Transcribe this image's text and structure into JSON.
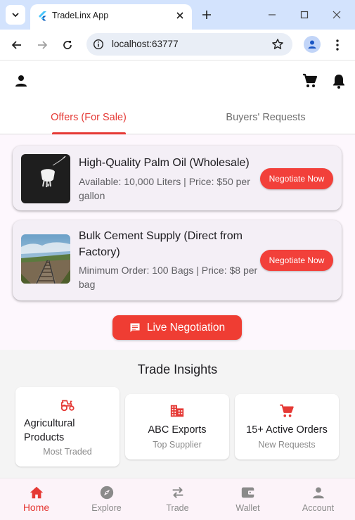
{
  "browser": {
    "tab_title": "TradeLinx App",
    "url": "localhost:63777"
  },
  "app": {
    "tabs": [
      {
        "label": "Offers (For Sale)",
        "active": true
      },
      {
        "label": "Buyers' Requests",
        "active": false
      }
    ],
    "offers": [
      {
        "title": "High-Quality Palm Oil (Wholesale)",
        "subtitle": "Available: 10,000 Liters | Price: $50 per gallon",
        "button": "Negotiate Now",
        "thumbnail": "palm-oil-photo"
      },
      {
        "title": "Bulk Cement Supply (Direct from Factory)",
        "subtitle": "Minimum Order: 100 Bags | Price: $8 per bag",
        "button": "Negotiate Now",
        "thumbnail": "railway-photo"
      }
    ],
    "live_negotiation_label": "Live Negotiation",
    "insights": {
      "title": "Trade Insights",
      "cards": [
        {
          "icon": "tractor-icon",
          "title": "Agricultural Products",
          "subtitle": "Most Traded"
        },
        {
          "icon": "business-icon",
          "title": "ABC Exports",
          "subtitle": "Top Supplier"
        },
        {
          "icon": "cart-icon",
          "title": "15+ Active Orders",
          "subtitle": "New Requests"
        }
      ]
    },
    "bottom_nav": [
      {
        "label": "Home",
        "icon": "home-icon",
        "active": true
      },
      {
        "label": "Explore",
        "icon": "compass-icon",
        "active": false
      },
      {
        "label": "Trade",
        "icon": "swap-icon",
        "active": false
      },
      {
        "label": "Wallet",
        "icon": "wallet-icon",
        "active": false
      },
      {
        "label": "Account",
        "icon": "person-icon",
        "active": false
      }
    ]
  },
  "colors": {
    "accent": "#e53935",
    "button": "#f2403a",
    "card_bg": "#f4eff6",
    "nav_bg": "#fcf3f9"
  }
}
